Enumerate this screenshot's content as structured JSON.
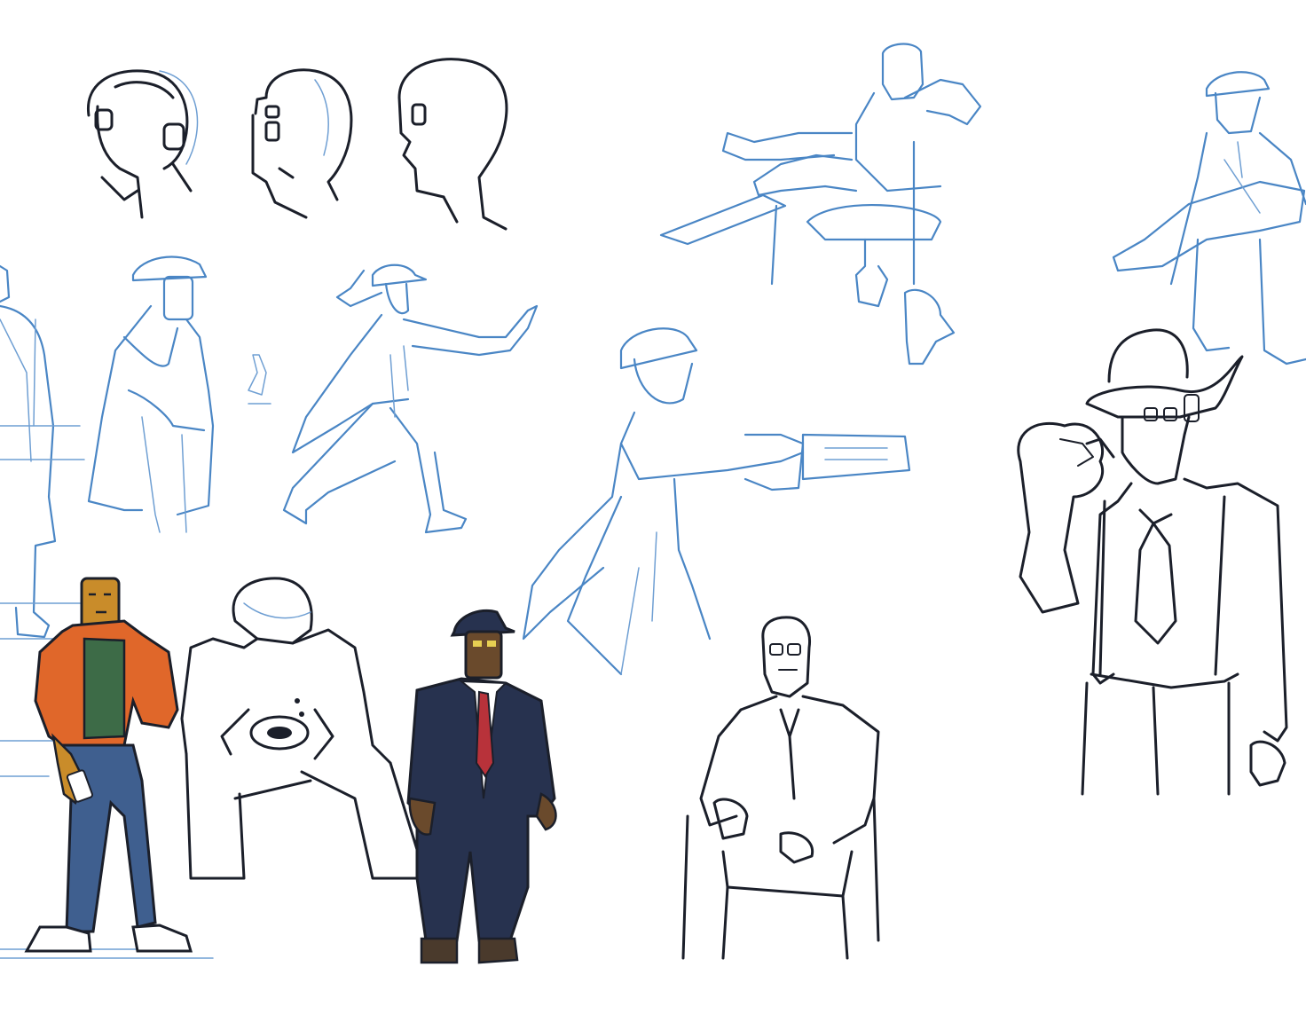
{
  "sheet": {
    "background": "#ffffff",
    "sketch_color": "#4a86c5",
    "ink_color": "#1b1f2a"
  },
  "colors": {
    "jacket_orange": "#e0672a",
    "shirt_green": "#3d6b47",
    "jeans_blue": "#3f5f8f",
    "robot_gold": "#c98c2a",
    "suit_navy": "#27324f",
    "tie_red": "#b8323a",
    "robot_brown": "#6a4a2c",
    "eye_yellow": "#e7cf52"
  }
}
